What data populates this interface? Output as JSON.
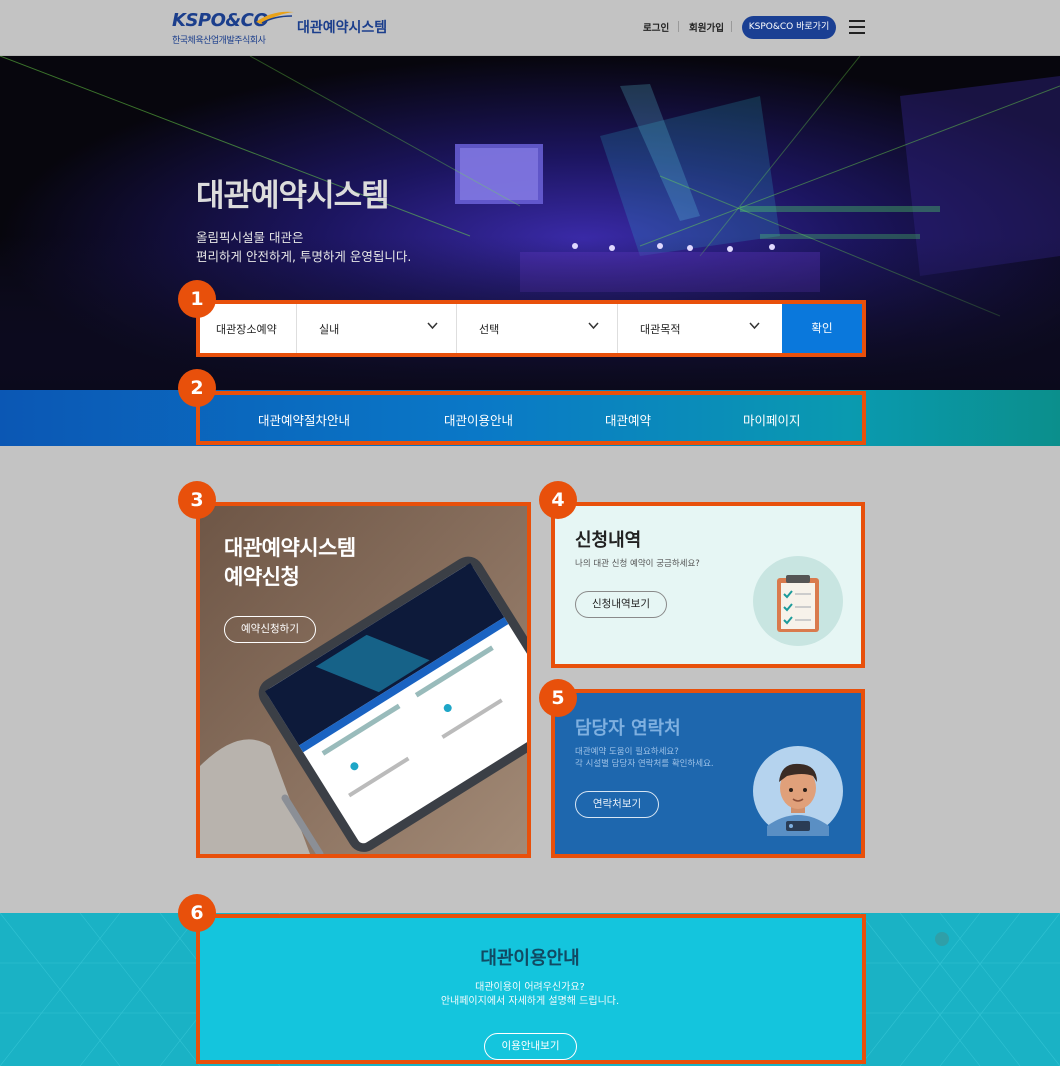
{
  "header": {
    "logo_text": "KSPO&CO",
    "logo_sub": "한국체육산업개발주식회사",
    "system_title": "대관예약시스템",
    "login": "로그인",
    "signup": "회원가입",
    "kspo_button": "KSPO&CO 바로가기",
    "menu_icon": "hamburger-icon"
  },
  "hero": {
    "title": "대관예약시스템",
    "subtitle_line1": "올림픽시설물 대관은",
    "subtitle_line2": "편리하게 안전하게, 투명하게 운영됩니다."
  },
  "search": {
    "label": "대관장소예약",
    "select1": "실내",
    "select2": "선택",
    "select3": "대관목적",
    "confirm": "확인"
  },
  "nav": {
    "items": [
      "대관예약절차안내",
      "대관이용안내",
      "대관예약",
      "마이페이지"
    ]
  },
  "badges": [
    "1",
    "2",
    "3",
    "4",
    "5",
    "6"
  ],
  "card_reserve": {
    "title_line1": "대관예약시스템",
    "title_line2": "예약신청",
    "button": "예약신청하기"
  },
  "card_history": {
    "title": "신청내역",
    "desc": "나의 대관 신청 예약이 궁금하세요?",
    "button": "신청내역보기",
    "icon": "clipboard-icon"
  },
  "card_contact": {
    "title": "담당자 연락처",
    "desc_line1": "대관예약 도움이 필요하세요?",
    "desc_line2": "각 시설별 담당자 연락처를 확인하세요.",
    "button": "연락처보기",
    "icon": "person-icon"
  },
  "usage_banner": {
    "title": "대관이용안내",
    "desc_line1": "대관이용이 어려우신가요?",
    "desc_line2": "안내페이지에서 자세하게 설명해 드립니다.",
    "button": "이용안내보기"
  },
  "colors": {
    "highlight": "#e8500b",
    "brand_blue": "#1a3f93",
    "confirm_blue": "#0a78dc",
    "teal": "#1ab2c5"
  }
}
